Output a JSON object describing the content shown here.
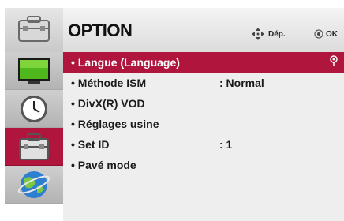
{
  "header": {
    "title": "OPTION",
    "nav_hint": "Dép.",
    "ok_hint": "OK",
    "nav_icon": "four-way-arrows-icon",
    "ok_icon": "ok-button-icon"
  },
  "sidebar": {
    "items": [
      {
        "name": "picture",
        "icon": "tv-screen-icon",
        "selected": false
      },
      {
        "name": "time",
        "icon": "clock-icon",
        "selected": false
      },
      {
        "name": "option",
        "icon": "toolbox-icon",
        "selected": true
      },
      {
        "name": "network",
        "icon": "globe-icon",
        "selected": false
      }
    ]
  },
  "menu": {
    "items": [
      {
        "label": "• Langue (Language)",
        "value": "",
        "selected": true
      },
      {
        "label": "• Méthode ISM",
        "value": ": Normal",
        "selected": false
      },
      {
        "label": "• DivX(R) VOD",
        "value": "",
        "selected": false
      },
      {
        "label": "• Réglages usine",
        "value": "",
        "selected": false
      },
      {
        "label": "• Set ID",
        "value": ": 1",
        "selected": false
      },
      {
        "label": "• Pavé mode",
        "value": "",
        "selected": false
      }
    ]
  },
  "colors": {
    "accent": "#b0163d",
    "panel": "#eeeeee",
    "sidebar": "#bdbdbd"
  }
}
